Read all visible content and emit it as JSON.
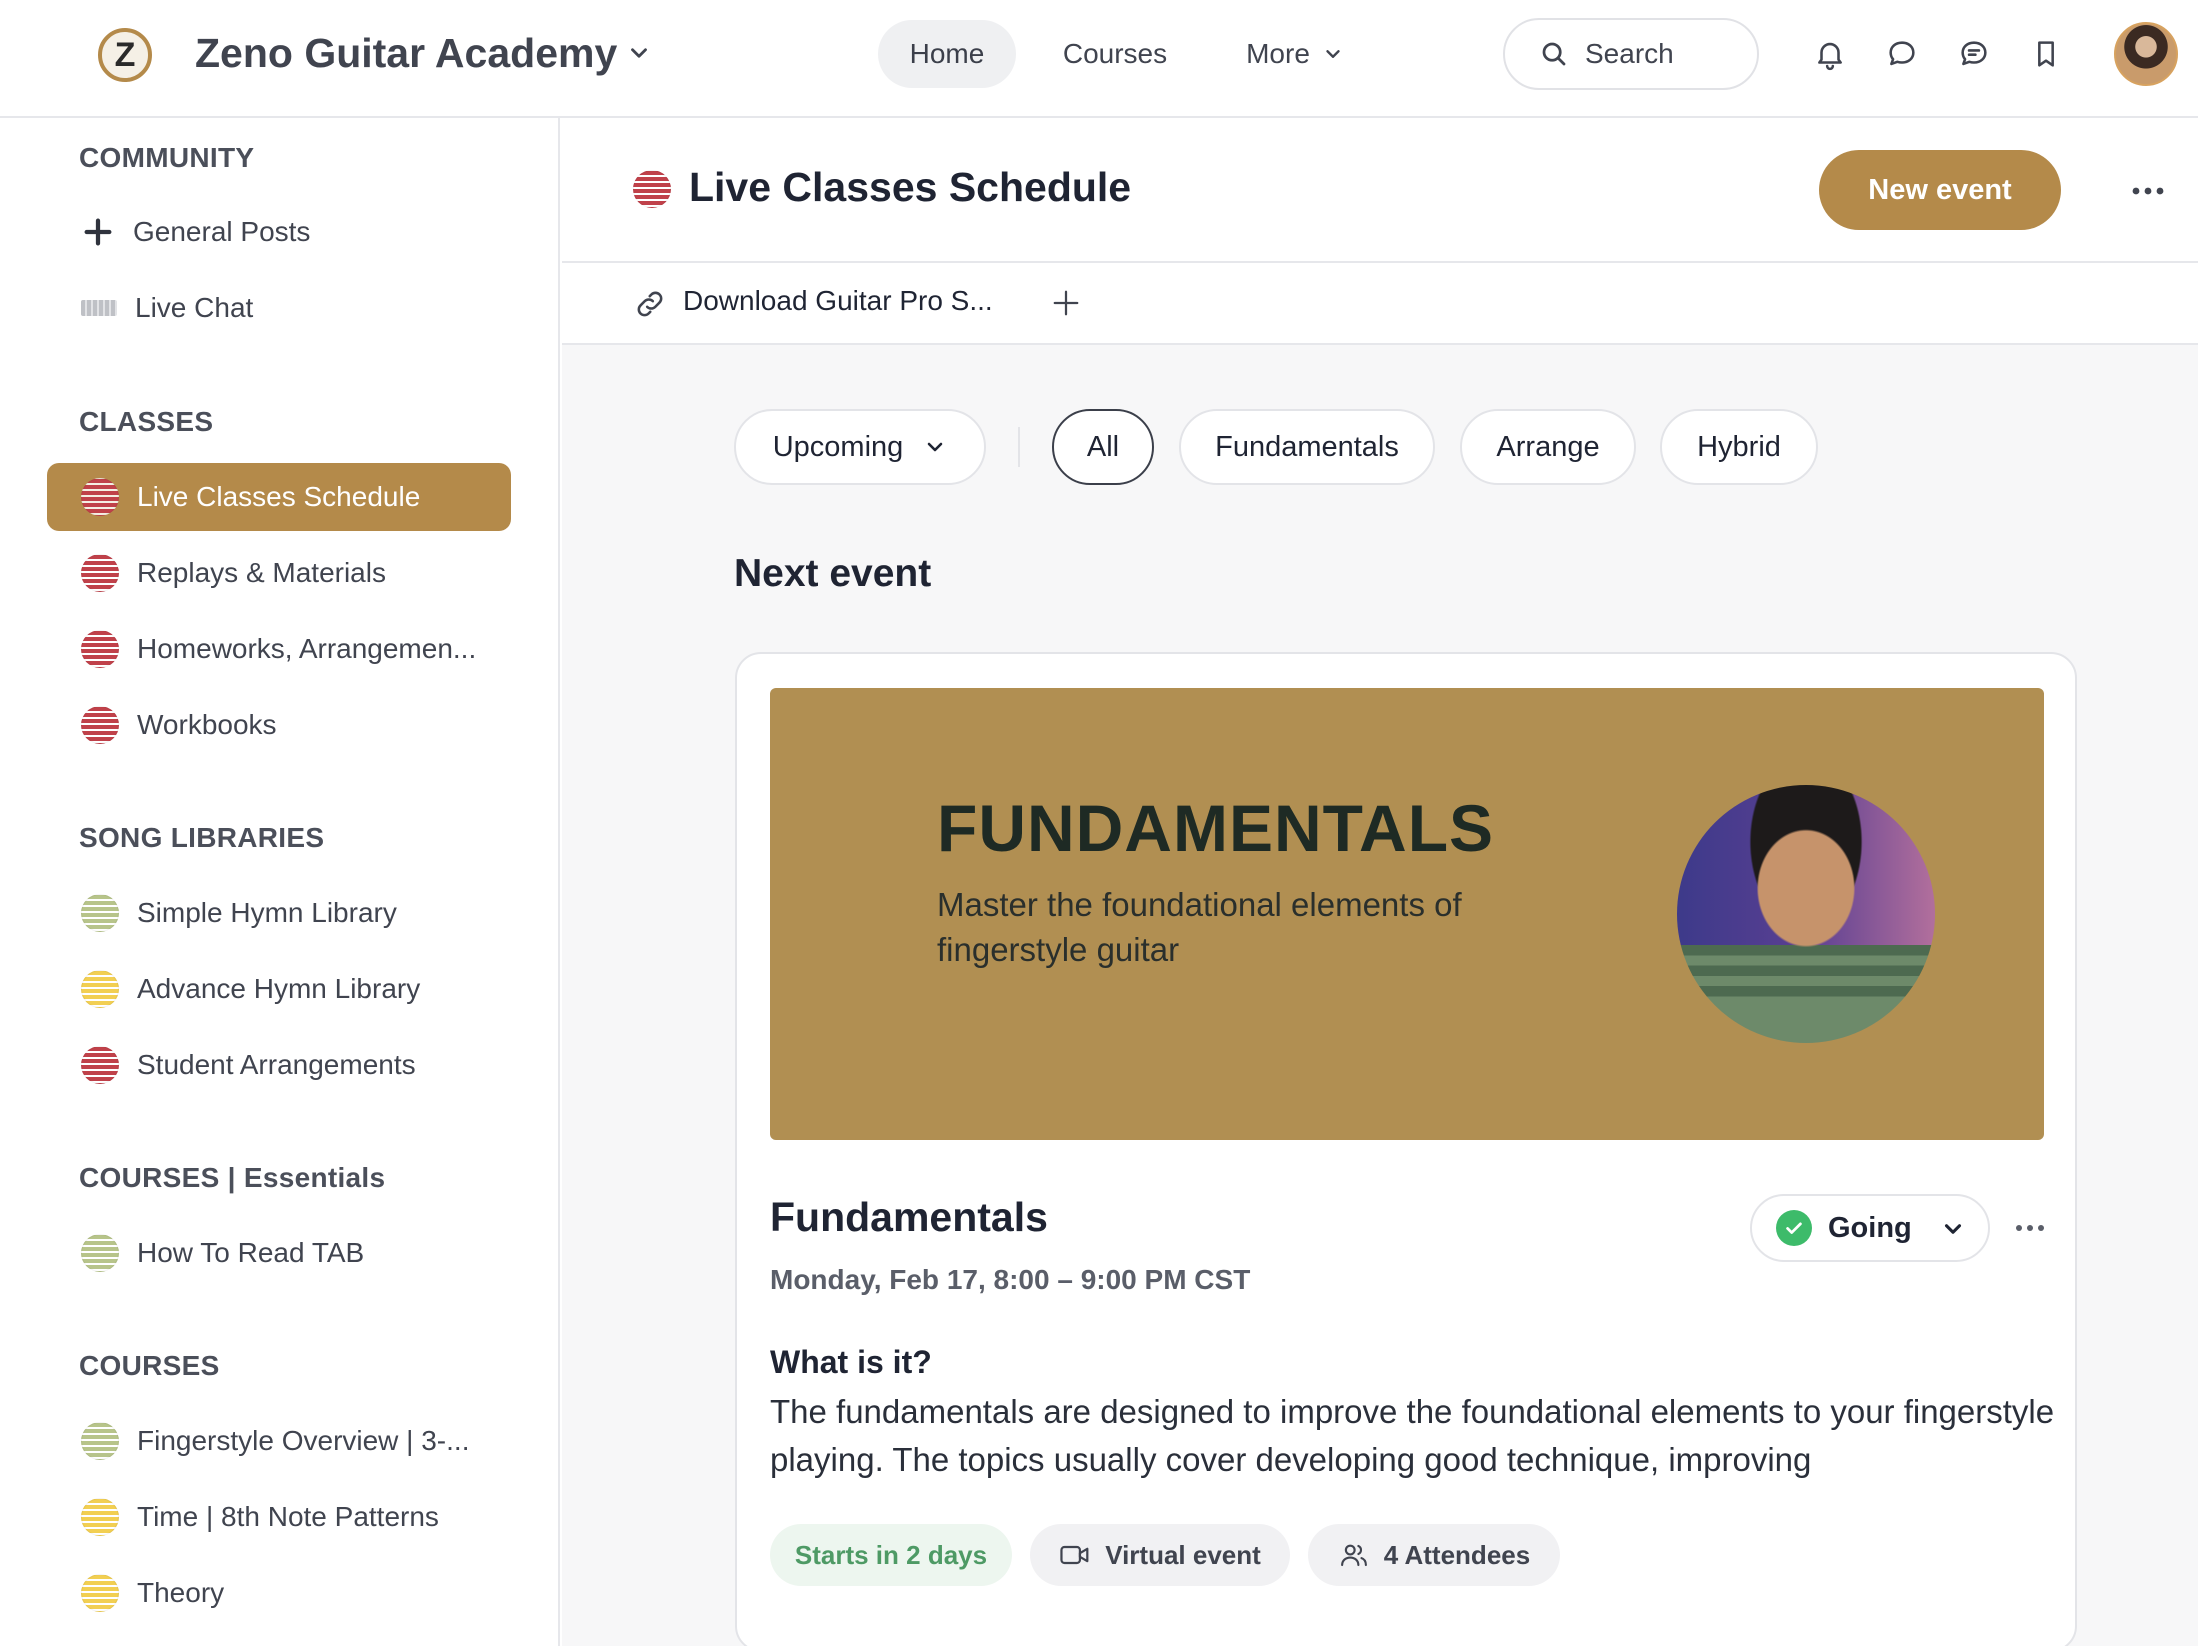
{
  "header": {
    "brand_name": "Zeno Guitar Academy",
    "brand_logo_letter": "Z",
    "nav": {
      "home": "Home",
      "courses": "Courses",
      "more": "More"
    },
    "search_label": "Search"
  },
  "sidebar": {
    "sections": [
      {
        "heading": "COMMUNITY",
        "items": [
          {
            "label": "General Posts",
            "icon": "plus-icon"
          },
          {
            "label": "Live Chat",
            "icon": "keyboard-icon"
          }
        ]
      },
      {
        "heading": "CLASSES",
        "items": [
          {
            "label": "Live Classes Schedule",
            "icon": "red-dot-icon",
            "active": true
          },
          {
            "label": "Replays & Materials",
            "icon": "red-dot-icon"
          },
          {
            "label": "Homeworks, Arrangemen...",
            "icon": "red-dot-icon"
          },
          {
            "label": "Workbooks",
            "icon": "red-dot-icon"
          }
        ]
      },
      {
        "heading": "SONG LIBRARIES",
        "items": [
          {
            "label": "Simple Hymn Library",
            "icon": "green-dot-icon"
          },
          {
            "label": "Advance Hymn Library",
            "icon": "yellow-dot-icon"
          },
          {
            "label": "Student Arrangements",
            "icon": "red-dot-icon"
          }
        ]
      },
      {
        "heading": "COURSES | Essentials",
        "items": [
          {
            "label": "How To Read TAB",
            "icon": "green-dot-icon"
          }
        ]
      },
      {
        "heading": "COURSES",
        "items": [
          {
            "label": "Fingerstyle Overview | 3-...",
            "icon": "green-dot-icon"
          },
          {
            "label": "Time | 8th Note Patterns",
            "icon": "yellow-dot-icon"
          },
          {
            "label": "Theory",
            "icon": "yellow-dot-icon"
          }
        ]
      }
    ]
  },
  "main": {
    "title": "Live Classes Schedule",
    "new_event_label": "New event",
    "link": {
      "label": "Download Guitar Pro S..."
    },
    "filters": {
      "time_filter": "Upcoming",
      "tags": [
        "All",
        "Fundamentals",
        "Arrange",
        "Hybrid"
      ],
      "selected": "All"
    },
    "next_event_heading": "Next event",
    "event": {
      "banner_title": "FUNDAMENTALS",
      "banner_subtitle": "Master the foundational elements of fingerstyle guitar",
      "name": "Fundamentals",
      "date": "Monday, Feb 17, 8:00 – 9:00 PM CST",
      "rsvp": "Going",
      "what_heading": "What is it?",
      "description": "The fundamentals are designed to improve the foundational elements to your fingerstyle playing. The topics usually cover developing good technique, improving",
      "tags": {
        "starts": "Starts in 2 days",
        "type": "Virtual event",
        "attendees": "4 Attendees"
      }
    }
  },
  "colors": {
    "accent": "#b48a4a",
    "red_dot": "#c0414a",
    "green_dot": "#b7c48a",
    "yellow_dot": "#f2cf52",
    "going_green": "#3dbb6a"
  }
}
